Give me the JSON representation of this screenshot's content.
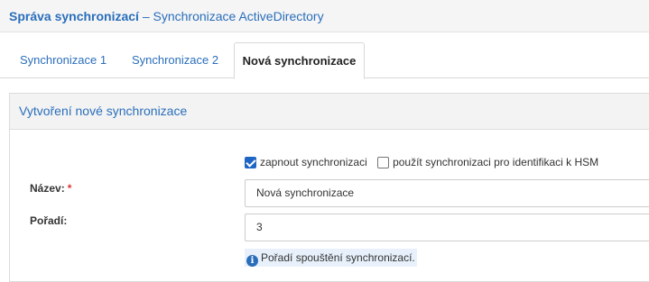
{
  "header": {
    "title_bold": "Správa synchronizací",
    "title_rest": " – Synchronizace ActiveDirectory"
  },
  "tabs": [
    {
      "label": "Synchronizace 1",
      "active": false
    },
    {
      "label": "Synchronizace 2",
      "active": false
    },
    {
      "label": "Nová synchronizace",
      "active": true
    }
  ],
  "panel": {
    "title": "Vytvoření nové synchronizace"
  },
  "form": {
    "enable_sync": {
      "label": "zapnout synchronizaci",
      "checked": true
    },
    "use_for_hsm": {
      "label": "použít synchronizaci pro identifikaci k HSM",
      "checked": false
    },
    "name": {
      "label": "Název:",
      "required_mark": "*",
      "value": "Nová synchronizace"
    },
    "order": {
      "label": "Pořadí:",
      "value": "3",
      "hint": "Pořadí spouštění synchronizací."
    }
  },
  "colors": {
    "accent": "#2a6ebb",
    "checkbox_checked": "#1f66c4",
    "required": "#dd3333",
    "hint_background": "#e8f1fb"
  }
}
